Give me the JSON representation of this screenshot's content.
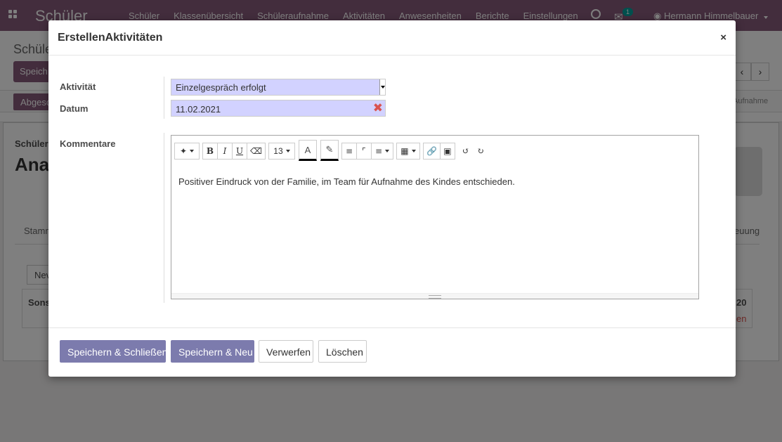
{
  "navbar": {
    "brand": "Schüler",
    "menu": [
      "Schüler",
      "Klassenübersicht",
      "Schüleraufnahme",
      "Aktivitäten",
      "Anwesenheiten",
      "Berichte",
      "Einstellungen"
    ],
    "chat_count": "1",
    "user": "Hermann Himmelbauer"
  },
  "control_panel": {
    "breadcrumb": "Schüle",
    "save_btn": "Speich",
    "status_left": "Abgesc",
    "status_right": "Aufnahme"
  },
  "sheet": {
    "label": "Schüler",
    "name": "Ana",
    "tab_left": "Stamm",
    "tab_right": "euung",
    "new_btn": "Nev",
    "box_left": "Sons",
    "box_right_top": "20",
    "box_right_bottom": "en"
  },
  "modal": {
    "title": "ErstellenAktivitäten",
    "close": "×",
    "fields": {
      "activity_label": "Aktivität",
      "activity_value": "Einzelgespräch erfolgt",
      "date_label": "Datum",
      "date_value": "11.02.2021",
      "comments_label": "Kommentare"
    },
    "editor": {
      "font_size": "13",
      "content": "Positiver Eindruck von der Familie, im Team für Aufnahme des Kindes entschieden."
    },
    "footer": {
      "save_close": "Speichern & Schließen",
      "save_new": "Speichern & Neu",
      "discard": "Verwerfen",
      "delete": "Löschen"
    }
  },
  "colors": {
    "navbar": "#875a7b",
    "primary_button": "#7c7bad",
    "required_field": "#d2d2ff",
    "clear_icon": "#d9534f"
  }
}
